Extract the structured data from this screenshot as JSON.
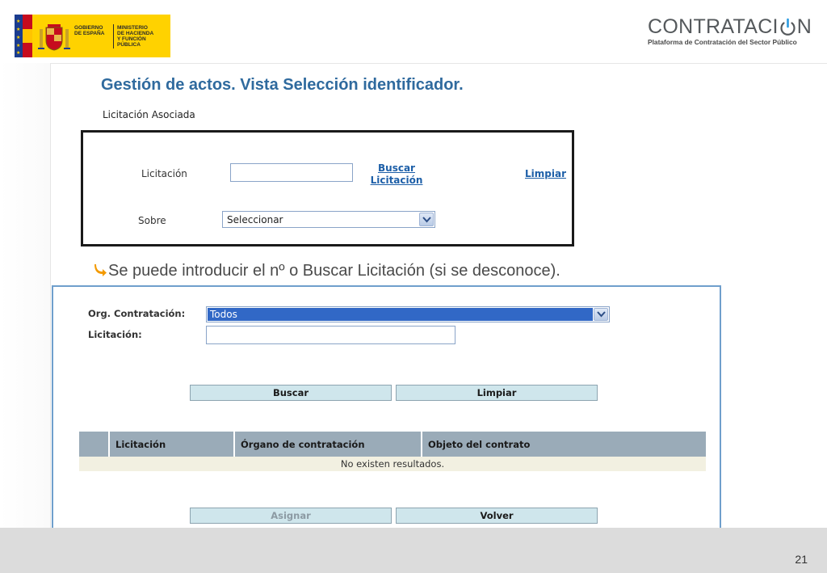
{
  "header": {
    "gov_line1": "GOBIERNO",
    "gov_line2": "DE ESPAÑA",
    "ministry_line1": "MINISTERIO",
    "ministry_line2": "DE HACIENDA",
    "ministry_line3": "Y FUNCIÓN PÚBLICA",
    "brand_prefix": "CONTRATACI",
    "brand_suffix": "N",
    "brand_subtitle": "Plataforma de Contratación del Sector Público",
    "colors": {
      "spain_red": "#c60b1e",
      "spain_yellow": "#ffc400",
      "eu_blue": "#1a3c8f",
      "brand_gray": "#55595c",
      "power_blue": "#2b9be0"
    }
  },
  "slide": {
    "title": "Gestión de actos. Vista Selección identificador.",
    "bullet_text": "Se puede introducir el nº o Buscar Licitación (si se desconoce).",
    "page_number": "21"
  },
  "panel_top": {
    "section_label": "Licitación Asociada",
    "licitacion_label": "Licitación",
    "licitacion_value": "",
    "buscar_line1": "Buscar",
    "buscar_line2": "Licitación",
    "limpiar_link": "Limpiar",
    "sobre_label": "Sobre",
    "sobre_selected": "Seleccionar"
  },
  "panel_search": {
    "org_label": "Org. Contratación:",
    "org_selected": "Todos",
    "licitacion_label": "Licitación:",
    "licitacion_value": "",
    "buscar_button": "Buscar",
    "limpiar_button": "Limpiar",
    "table": {
      "columns": [
        "",
        "Licitación",
        "Órgano de contratación",
        "Objeto del contrato"
      ],
      "empty_message": "No existen resultados."
    },
    "asignar_button": "Asignar",
    "volver_button": "Volver"
  }
}
